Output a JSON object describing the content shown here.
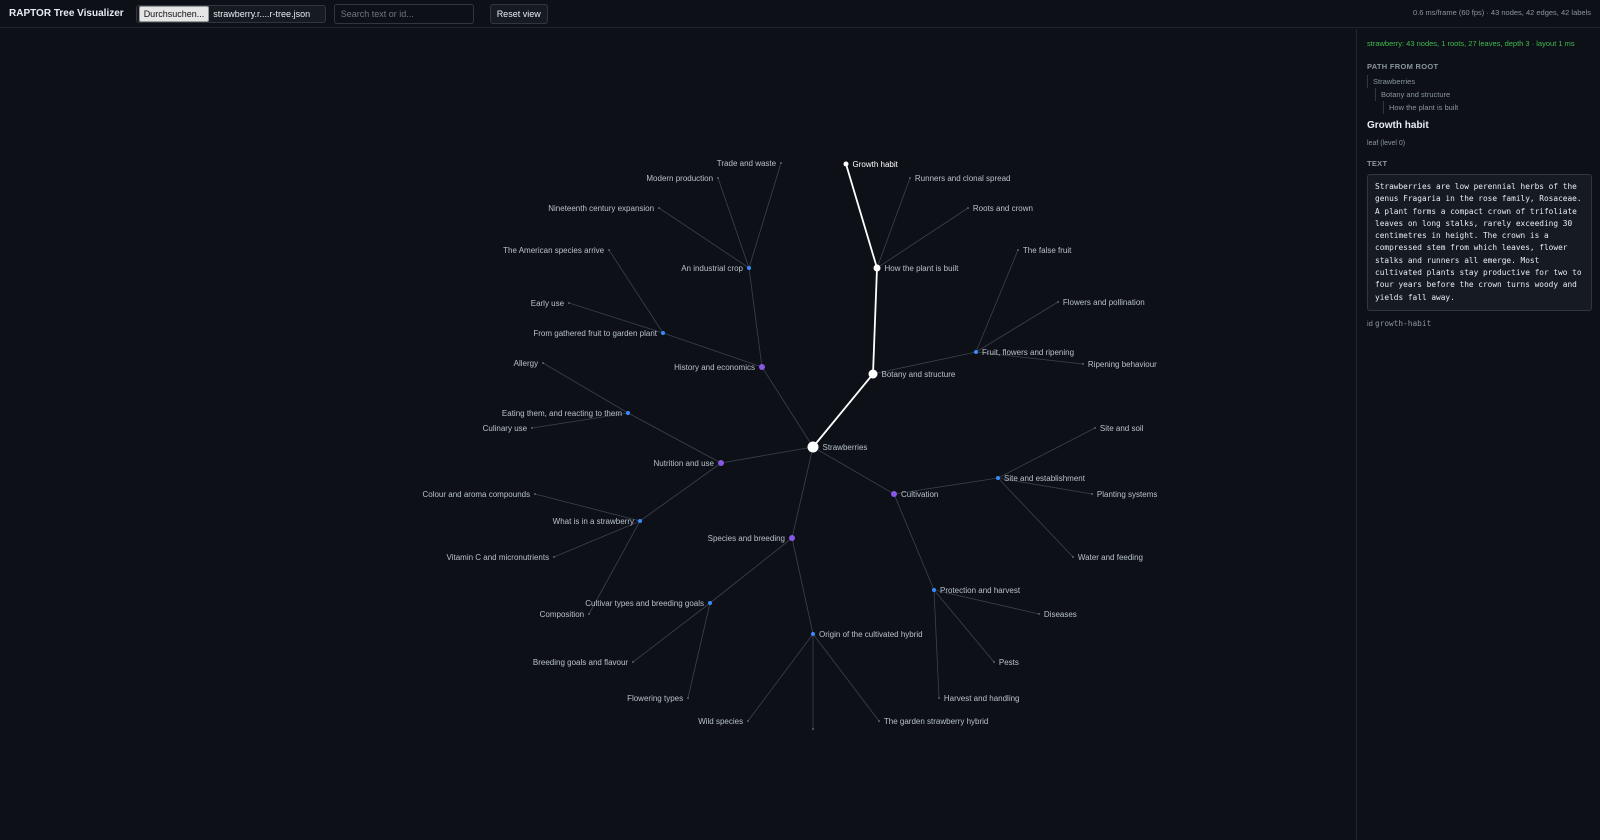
{
  "app": {
    "title": "RAPTOR Tree Visualizer"
  },
  "toolbar": {
    "file_button_label": "Durchsuchen...",
    "file_name": "strawberry.r....r-tree.json",
    "search_placeholder": "Search text or id...",
    "reset_label": "Reset view",
    "stats": "0.6 ms/frame (60 fps) · 43 nodes, 42 edges, 42 labels"
  },
  "colors": {
    "background": "#0d1117",
    "edge": "#3a4150",
    "selected_path": "#ffffff",
    "level2_node": "#8957e5",
    "level1_node": "#388bfd",
    "leaf_node": "#6e7681",
    "summary": "#3fb950"
  },
  "graph": {
    "nodes": [
      {
        "id": "root",
        "label": "Strawberries",
        "level": 3
      },
      {
        "id": "botany",
        "label": "Botany and structure",
        "level": 2,
        "parent": "root"
      },
      {
        "id": "history",
        "label": "History and economics",
        "level": 2,
        "parent": "root"
      },
      {
        "id": "nutrition",
        "label": "Nutrition and use",
        "level": 2,
        "parent": "root"
      },
      {
        "id": "species",
        "label": "Species and breeding",
        "level": 2,
        "parent": "root"
      },
      {
        "id": "cultivation",
        "label": "Cultivation",
        "level": 2,
        "parent": "root"
      },
      {
        "id": "how-built",
        "label": "How the plant is built",
        "level": 1,
        "parent": "botany"
      },
      {
        "id": "fruit",
        "label": "Fruit, flowers and ripening",
        "level": 1,
        "parent": "botany"
      },
      {
        "id": "industrial",
        "label": "An industrial crop",
        "level": 1,
        "parent": "history"
      },
      {
        "id": "gathered",
        "label": "From gathered fruit to garden plant",
        "level": 1,
        "parent": "history"
      },
      {
        "id": "eating",
        "label": "Eating them, and reacting to them",
        "level": 1,
        "parent": "nutrition"
      },
      {
        "id": "whatis",
        "label": "What is in a strawberry",
        "level": 1,
        "parent": "nutrition"
      },
      {
        "id": "cultivar",
        "label": "Cultivar types and breeding goals",
        "level": 1,
        "parent": "species"
      },
      {
        "id": "origin",
        "label": "Origin of the cultivated hybrid",
        "level": 1,
        "parent": "species"
      },
      {
        "id": "site",
        "label": "Site and establishment",
        "level": 1,
        "parent": "cultivation"
      },
      {
        "id": "protection",
        "label": "Protection and harvest",
        "level": 1,
        "parent": "cultivation"
      },
      {
        "id": "growth-habit",
        "label": "Growth habit",
        "level": 0,
        "parent": "how-built"
      },
      {
        "id": "runners",
        "label": "Runners and clonal spread",
        "level": 0,
        "parent": "how-built"
      },
      {
        "id": "roots",
        "label": "Roots and crown",
        "level": 0,
        "parent": "how-built"
      },
      {
        "id": "false-fruit",
        "label": "The false fruit",
        "level": 0,
        "parent": "fruit"
      },
      {
        "id": "flowers",
        "label": "Flowers and pollination",
        "level": 0,
        "parent": "fruit"
      },
      {
        "id": "ripening",
        "label": "Ripening behaviour",
        "level": 0,
        "parent": "fruit"
      },
      {
        "id": "trade",
        "label": "Trade and waste",
        "level": 0,
        "parent": "industrial"
      },
      {
        "id": "modern",
        "label": "Modern production",
        "level": 0,
        "parent": "industrial"
      },
      {
        "id": "nineteenth",
        "label": "Nineteenth century expansion",
        "level": 0,
        "parent": "industrial"
      },
      {
        "id": "american",
        "label": "The American species arrive",
        "level": 0,
        "parent": "gathered"
      },
      {
        "id": "early",
        "label": "Early use",
        "level": 0,
        "parent": "gathered"
      },
      {
        "id": "allergy",
        "label": "Allergy",
        "level": 0,
        "parent": "eating"
      },
      {
        "id": "culinary",
        "label": "Culinary use",
        "level": 0,
        "parent": "eating"
      },
      {
        "id": "colour",
        "label": "Colour and aroma compounds",
        "level": 0,
        "parent": "whatis"
      },
      {
        "id": "vitamin",
        "label": "Vitamin C and micronutrients",
        "level": 0,
        "parent": "whatis"
      },
      {
        "id": "composition",
        "label": "Composition",
        "level": 0,
        "parent": "whatis"
      },
      {
        "id": "breeding-goals",
        "label": "Breeding goals and flavour",
        "level": 0,
        "parent": "cultivar"
      },
      {
        "id": "flowering",
        "label": "Flowering types",
        "level": 0,
        "parent": "cultivar"
      },
      {
        "id": "wild",
        "label": "Wild species",
        "level": 0,
        "parent": "origin"
      },
      {
        "id": "unlabeled",
        "label": "",
        "level": 0,
        "parent": "origin"
      },
      {
        "id": "garden-hybrid",
        "label": "The garden strawberry hybrid",
        "level": 0,
        "parent": "origin"
      },
      {
        "id": "soil",
        "label": "Site and soil",
        "level": 0,
        "parent": "site"
      },
      {
        "id": "planting",
        "label": "Planting systems",
        "level": 0,
        "parent": "site"
      },
      {
        "id": "water",
        "label": "Water and feeding",
        "level": 0,
        "parent": "site"
      },
      {
        "id": "diseases",
        "label": "Diseases",
        "level": 0,
        "parent": "protection"
      },
      {
        "id": "pests",
        "label": "Pests",
        "level": 0,
        "parent": "protection"
      },
      {
        "id": "harvest",
        "label": "Harvest and handling",
        "level": 0,
        "parent": "protection"
      }
    ],
    "selected_path": [
      "root",
      "botany",
      "how-built",
      "growth-habit"
    ]
  },
  "sidebar": {
    "summary": "strawberry: 43 nodes, 1 roots, 27 leaves, depth 3 · layout 1 ms",
    "path_heading": "PATH FROM ROOT",
    "path": [
      "Strawberries",
      "Botany and structure",
      "How the plant is built"
    ],
    "selected_title": "Growth habit",
    "selected_meta": "leaf (level 0)",
    "text_heading": "TEXT",
    "text": "Strawberries are low perennial herbs of the genus Fragaria in the rose family, Rosaceae. A plant forms a compact crown of trifoliate leaves on long stalks, rarely exceeding 30 centimetres in height. The crown is a compressed stem from which leaves, flower stalks and runners all emerge. Most cultivated plants stay productive for two to four years before the crown turns woody and yields fall away.",
    "id_label": "id",
    "id_value": "growth-habit"
  }
}
